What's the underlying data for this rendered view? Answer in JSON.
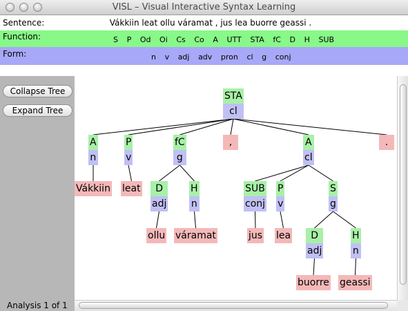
{
  "window": {
    "title": "VISL – Visual Interactive Syntax Learning"
  },
  "header": {
    "sentence_label": "Sentence:",
    "sentence": "Vákkiin leat ollu váramat , jus lea buorre geassi .",
    "function_label": "Function:",
    "function_tags": [
      "S",
      "P",
      "Od",
      "Oi",
      "Cs",
      "Co",
      "A",
      "UTT",
      "STA",
      "fC",
      "D",
      "H",
      "SUB"
    ],
    "form_label": "Form:",
    "form_tags": [
      "n",
      "v",
      "adj",
      "adv",
      "pron",
      "cl",
      "g",
      "conj"
    ]
  },
  "sidebar": {
    "collapse_label": "Collapse Tree",
    "expand_label": "Expand Tree",
    "analysis_label": "Analysis 1 of 1"
  },
  "colors": {
    "function": "#a8f0a8",
    "form": "#c0c0f4",
    "word": "#f4b8b8",
    "function_bar": "#88f888",
    "form_bar": "#a8a8f8"
  },
  "tree": {
    "nodes": [
      {
        "id": "root",
        "function": "STA",
        "form": "cl"
      },
      {
        "id": "n1",
        "parent": "root",
        "function": "A",
        "form": "n"
      },
      {
        "id": "n2",
        "parent": "root",
        "function": "P",
        "form": "v"
      },
      {
        "id": "n3",
        "parent": "root",
        "function": "fC",
        "form": "g"
      },
      {
        "id": "n4",
        "parent": "root",
        "word": ","
      },
      {
        "id": "n5",
        "parent": "root",
        "function": "A",
        "form": "cl"
      },
      {
        "id": "n6",
        "parent": "root",
        "word": "."
      },
      {
        "id": "w1",
        "parent": "n1",
        "word": "Vákkiin"
      },
      {
        "id": "w2",
        "parent": "n2",
        "word": "leat"
      },
      {
        "id": "n3a",
        "parent": "n3",
        "function": "D",
        "form": "adj"
      },
      {
        "id": "n3b",
        "parent": "n3",
        "function": "H",
        "form": "n"
      },
      {
        "id": "w3",
        "parent": "n3a",
        "word": "ollu"
      },
      {
        "id": "w4",
        "parent": "n3b",
        "word": "váramat"
      },
      {
        "id": "n5a",
        "parent": "n5",
        "function": "SUB",
        "form": "conj"
      },
      {
        "id": "n5b",
        "parent": "n5",
        "function": "P",
        "form": "v"
      },
      {
        "id": "n5c",
        "parent": "n5",
        "function": "S",
        "form": "g"
      },
      {
        "id": "w5",
        "parent": "n5a",
        "word": "jus"
      },
      {
        "id": "w6",
        "parent": "n5b",
        "word": "lea"
      },
      {
        "id": "n5c1",
        "parent": "n5c",
        "function": "D",
        "form": "adj"
      },
      {
        "id": "n5c2",
        "parent": "n5c",
        "function": "H",
        "form": "n"
      },
      {
        "id": "w7",
        "parent": "n5c1",
        "word": "buorre"
      },
      {
        "id": "w8",
        "parent": "n5c2",
        "word": "geassi"
      }
    ]
  }
}
